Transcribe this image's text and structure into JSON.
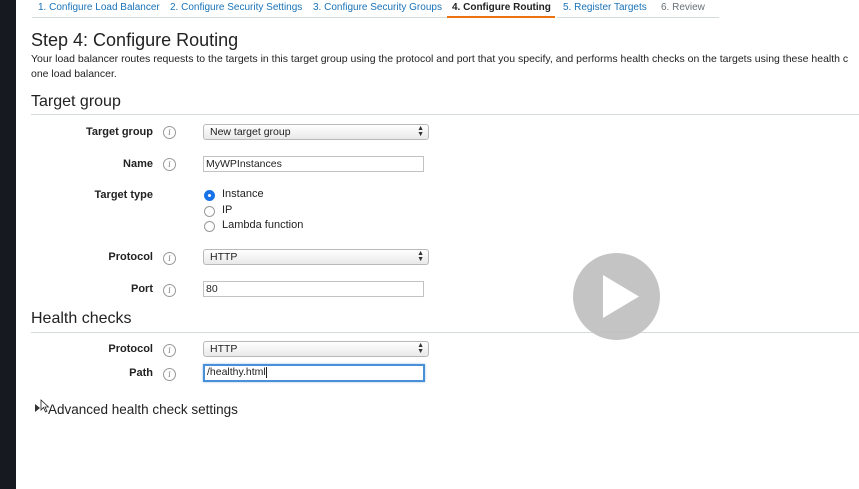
{
  "tabs": [
    {
      "label": "1. Configure Load Balancer",
      "state": "done"
    },
    {
      "label": "2. Configure Security Settings",
      "state": "done"
    },
    {
      "label": "3. Configure Security Groups",
      "state": "done"
    },
    {
      "label": "4. Configure Routing",
      "state": "active"
    },
    {
      "label": "5. Register Targets",
      "state": "upcoming"
    },
    {
      "label": "6. Review",
      "state": "upcoming"
    }
  ],
  "page": {
    "title": "Step 4: Configure Routing",
    "intro_line1": "Your load balancer routes requests to the targets in this target group using the protocol and port that you specify, and performs health checks on the targets using these health c",
    "intro_line2": "one load balancer."
  },
  "target_group": {
    "section_title": "Target group",
    "target_group_label": "Target group",
    "target_group_value": "New target group",
    "name_label": "Name",
    "name_value": "MyWPInstances",
    "target_type_label": "Target type",
    "target_type_options": [
      {
        "label": "Instance",
        "checked": true
      },
      {
        "label": "IP",
        "checked": false
      },
      {
        "label": "Lambda function",
        "checked": false
      }
    ],
    "protocol_label": "Protocol",
    "protocol_value": "HTTP",
    "port_label": "Port",
    "port_value": "80"
  },
  "health_checks": {
    "section_title": "Health checks",
    "protocol_label": "Protocol",
    "protocol_value": "HTTP",
    "path_label": "Path",
    "path_value": "/healthy.html",
    "advanced_label": "Advanced health check settings"
  },
  "icons": {
    "info": "info-icon",
    "select_arrows": "select-arrows-icon",
    "play": "play-icon",
    "cursor": "mouse-cursor-icon"
  },
  "colors": {
    "active_tab_underline": "#ec7211",
    "link": "#1a73b8",
    "focus": "#4a90d9",
    "radio_checked": "#1a73e8"
  }
}
